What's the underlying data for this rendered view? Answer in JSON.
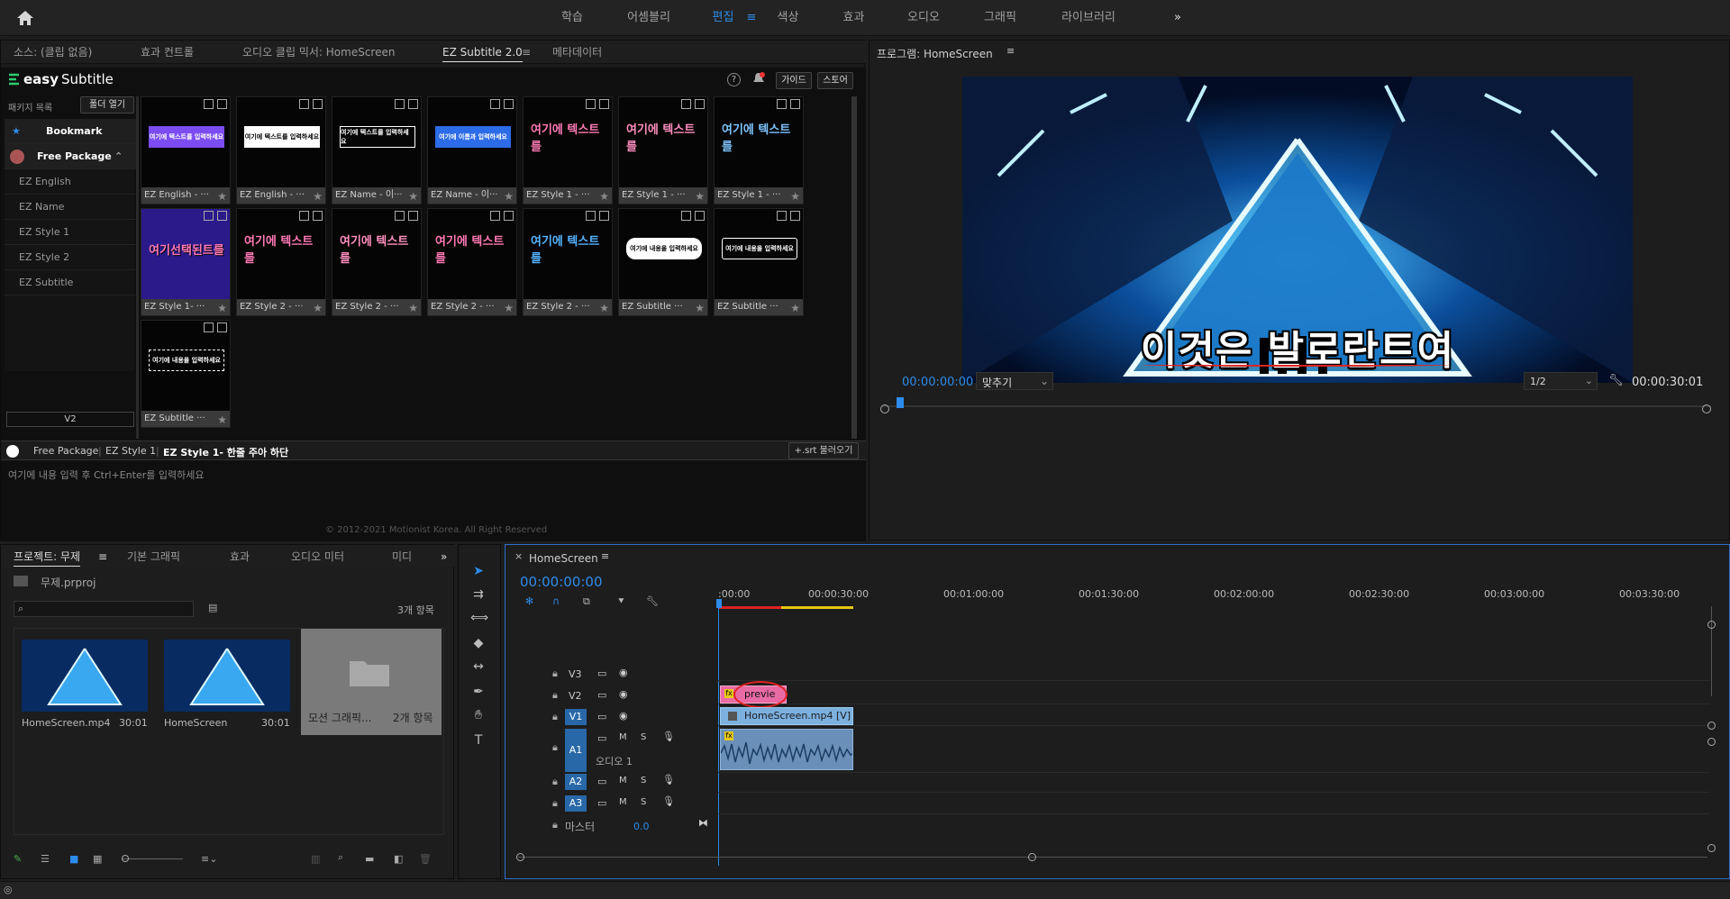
{
  "workspace": {
    "tabs": [
      "학습",
      "어셈블리",
      "편집",
      "색상",
      "효과",
      "오디오",
      "그래픽",
      "라이브러리"
    ],
    "active": "편집",
    "more": "»"
  },
  "source_panel": {
    "tabs": [
      "소스: (클립 없음)",
      "효과 컨트롤",
      "오디오 클립 믹서: HomeScreen",
      "EZ Subtitle 2.0",
      "메타데이터"
    ],
    "active_tab": "EZ Subtitle 2.0"
  },
  "ez": {
    "brand_prefix": "easy",
    "brand_suffix": "Subtitle",
    "help": "?",
    "guide": "가이드",
    "store": "스토어",
    "package_list": "패키지 목록",
    "open_folder": "폴더 열기",
    "bookmark": "Bookmark",
    "free_package": "Free Package",
    "sidebar_items": [
      "EZ English",
      "EZ Name",
      "EZ Style 1",
      "EZ Style 2",
      "EZ Subtitle"
    ],
    "version": "V2",
    "thumbs": [
      {
        "label": "EZ English - ···",
        "art": "여기에 텍스트를 입력하세요",
        "style": "purple"
      },
      {
        "label": "EZ English - ···",
        "art": "여기에 텍스트를 입력하세요",
        "style": "white"
      },
      {
        "label": "EZ Name - 이···",
        "art": "여기에 텍스트를 입력하세요",
        "style": "outline"
      },
      {
        "label": "EZ Name - 이···",
        "art": "여기에 이름과 입력하세요",
        "style": "bluebar"
      },
      {
        "label": "EZ Style 1 - ···",
        "art": "여기에 텍스트를",
        "style": "pinkbig"
      },
      {
        "label": "EZ Style 1 - ···",
        "art": "여기에 텍스트를",
        "style": "pinkbig2"
      },
      {
        "label": "EZ Style 1 - ···",
        "art": "여기에 텍스트를",
        "style": "bluebig"
      },
      {
        "label": "EZ Style 1- ···",
        "art": "여기선택된트를",
        "style": "purplebg"
      },
      {
        "label": "EZ Style 2 - ···",
        "art": "여기에 텍스트를",
        "style": "pinkbig"
      },
      {
        "label": "EZ Style 2 - ···",
        "art": "여기에 텍스트를",
        "style": "pinkbig2"
      },
      {
        "label": "EZ Style 2 - ···",
        "art": "여기에 텍스트를",
        "style": "pinkbig"
      },
      {
        "label": "EZ Style 2 - ···",
        "art": "여기에 텍스트를",
        "style": "bluebig2"
      },
      {
        "label": "EZ Subtitle ···",
        "art": "여기에 내용을 입력하세요",
        "style": "pill"
      },
      {
        "label": "EZ Subtitle ···",
        "art": "여기에 내용을 입력하세요",
        "style": "box"
      },
      {
        "label": "EZ Subtitle ···",
        "art": "여기에 내용을 입력하세요",
        "style": "dashed"
      }
    ],
    "breadcrumb": [
      "Free Package",
      "EZ Style 1",
      "EZ Style 1- 한줄 주아 하단"
    ],
    "srt_button": "+.srt 불러오기",
    "input_placeholder": "여기에 내용 입력 후 Ctrl+Enter를 입력하세요",
    "copyright": "© 2012-2021 Motionist Korea. All Right Reserved"
  },
  "program": {
    "title": "프로그램: HomeScreen",
    "subtitle": "이것은 발로란트여",
    "timecode": "00:00:00:00",
    "fit": "맞추기",
    "resolution": "1/2",
    "duration": "00:00:30:01"
  },
  "project": {
    "tabs": [
      "프로젝트: 무제",
      "기본 그래픽",
      "효과",
      "오디오 미터",
      "미디"
    ],
    "file": "무제.prproj",
    "count": "3개 항목",
    "items": [
      {
        "name": "HomeScreen.mp4",
        "duration": "30:01"
      },
      {
        "name": "HomeScreen",
        "duration": "30:01"
      },
      {
        "name": "모션 그래픽...",
        "duration": "2개 항목"
      }
    ]
  },
  "timeline": {
    "title": "HomeScreen",
    "timecode": "00:00:00:00",
    "ruler": [
      ":00:00",
      "00:00:30:00",
      "00:01:00:00",
      "00:01:30:00",
      "00:02:00:00",
      "00:02:30:00",
      "00:03:00:00",
      "00:03:30:00"
    ],
    "tracks": {
      "v3": "V3",
      "v2": "V2",
      "v1": "V1",
      "a1": "A1",
      "a2": "A2",
      "a3": "A3"
    },
    "audio_label": "오디오 1",
    "master": "마스터",
    "master_value": "0.0",
    "clip_v2": "previe",
    "clip_v1": "HomeScreen.mp4 [V]",
    "mute": "M",
    "solo": "S"
  },
  "colors": {
    "accent": "#2d8ceb",
    "pink": "#e86ba5",
    "clip_blue": "#7cb0df"
  }
}
